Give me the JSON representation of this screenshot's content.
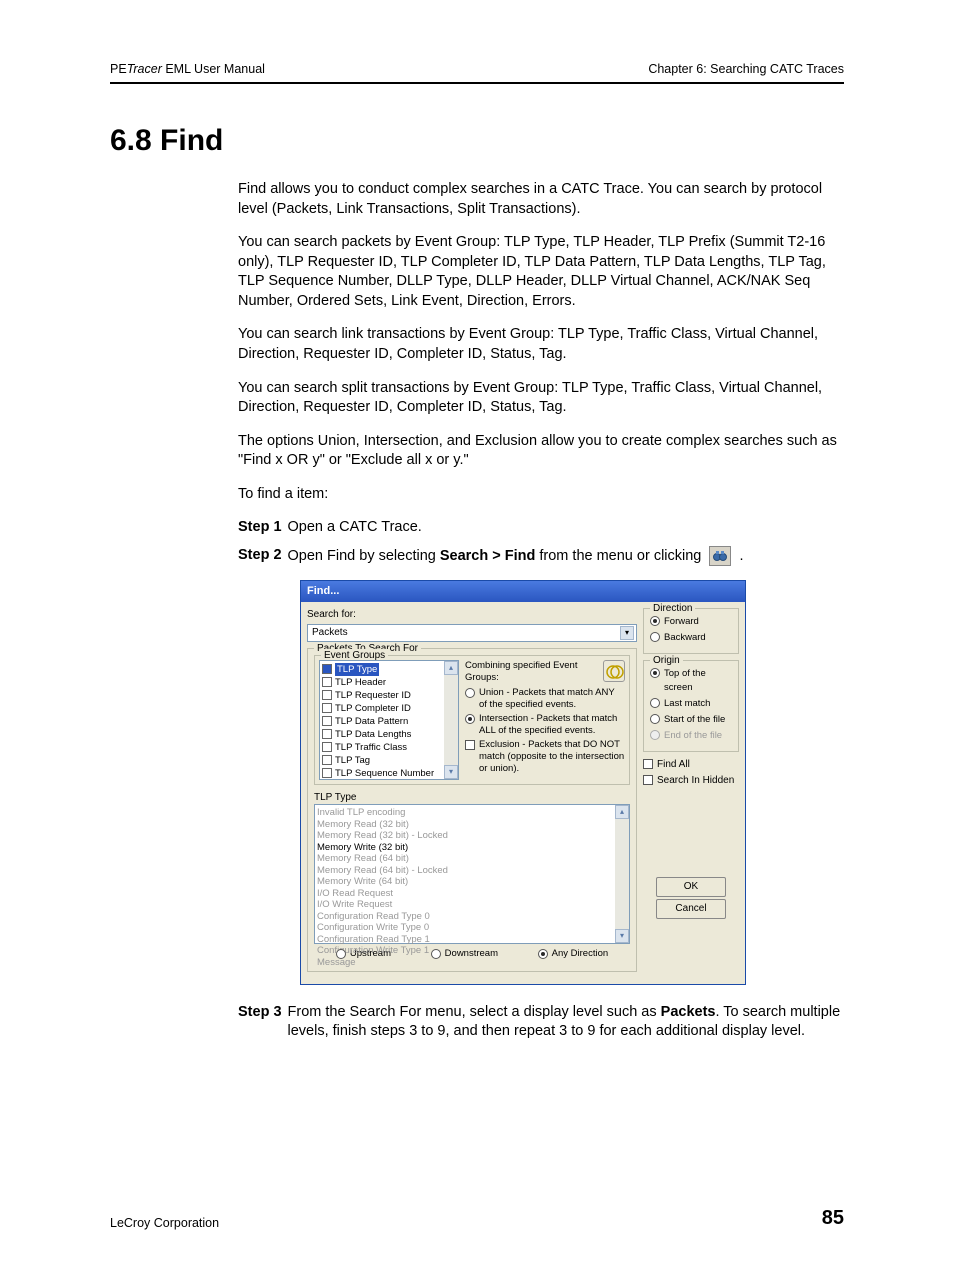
{
  "header": {
    "left_prefix": "PE",
    "left_italic": "Tracer",
    "left_suffix": " EML User Manual",
    "right": "Chapter 6: Searching CATC Traces"
  },
  "heading": "6.8 Find",
  "paragraphs": {
    "p1": "Find allows you to conduct complex searches in a CATC Trace. You can search by protocol level (Packets, Link Transactions, Split Transactions).",
    "p2": "You can search packets by Event Group: TLP Type, TLP Header, TLP Prefix (Summit T2-16 only), TLP Requester ID, TLP Completer ID, TLP Data Pattern, TLP Data Lengths, TLP Tag, TLP Sequence Number,  DLLP Type, DLLP Header, DLLP Virtual Channel, ACK/NAK Seq Number, Ordered Sets, Link Event, Direction, Errors.",
    "p3": "You can search link transactions by Event Group: TLP Type, Traffic Class, Virtual Channel, Direction, Requester ID, Completer ID, Status, Tag.",
    "p4": "You can search split transactions by Event Group: TLP Type, Traffic Class, Virtual Channel, Direction, Requester ID, Completer ID, Status, Tag.",
    "p5": "The options Union, Intersection, and Exclusion allow you to create complex searches such as \"Find x OR y\" or \"Exclude all x or y.\"",
    "p6": "To find a item:"
  },
  "steps": {
    "s1_label": "Step 1",
    "s1_text": "Open a CATC Trace.",
    "s2_label": "Step 2",
    "s2_pre": "Open Find by selecting ",
    "s2_bold": "Search > Find",
    "s2_post": " from the menu or clicking ",
    "s2_tail": " .",
    "s3_label": "Step 3",
    "s3_pre": "From the Search For menu, select a display level such as ",
    "s3_bold": "Packets",
    "s3_post": ". To search multiple levels, finish steps 3 to 9, and then repeat 3 to 9 for each additional display level."
  },
  "dialog": {
    "title": "Find...",
    "search_for_label": "Search for:",
    "search_for_value": "Packets",
    "packets_group": "Packets To Search For",
    "event_groups_label": "Event Groups",
    "event_items": [
      {
        "label": "TLP Type",
        "checked": true
      },
      {
        "label": "TLP Header",
        "checked": false
      },
      {
        "label": "TLP Requester ID",
        "checked": false
      },
      {
        "label": "TLP Completer ID",
        "checked": false
      },
      {
        "label": "TLP Data Pattern",
        "checked": false
      },
      {
        "label": "TLP Data Lengths",
        "checked": false
      },
      {
        "label": "TLP Traffic Class",
        "checked": false
      },
      {
        "label": "TLP Tag",
        "checked": false
      },
      {
        "label": "TLP Sequence Number",
        "checked": false
      }
    ],
    "combining_label": "Combining specified Event Groups:",
    "combine_union": "Union - Packets that match ANY of the specified events.",
    "combine_intersection": "Intersection - Packets that match ALL of the specified events.",
    "combine_exclusion": "Exclusion - Packets that DO NOT match (opposite to the intersection or union).",
    "tlp_type_label": "TLP Type",
    "tlp_items": [
      {
        "label": "Invalid TLP encoding",
        "enabled": false
      },
      {
        "label": "Memory Read (32 bit)",
        "enabled": false
      },
      {
        "label": "Memory Read (32 bit) - Locked",
        "enabled": false
      },
      {
        "label": "Memory Write (32 bit)",
        "enabled": true
      },
      {
        "label": "Memory Read (64 bit)",
        "enabled": false
      },
      {
        "label": "Memory Read (64 bit) - Locked",
        "enabled": false
      },
      {
        "label": "Memory Write (64 bit)",
        "enabled": false
      },
      {
        "label": "I/O Read Request",
        "enabled": false
      },
      {
        "label": "I/O Write Request",
        "enabled": false
      },
      {
        "label": "Configuration Read Type 0",
        "enabled": false
      },
      {
        "label": "Configuration Write Type 0",
        "enabled": false
      },
      {
        "label": "Configuration Read Type 1",
        "enabled": false
      },
      {
        "label": "Configuration Write Type 1",
        "enabled": false
      },
      {
        "label": "Message",
        "enabled": false
      }
    ],
    "dir_upstream": "Upstream",
    "dir_downstream": "Downstream",
    "dir_any": "Any Direction",
    "direction_group": "Direction",
    "dir_forward": "Forward",
    "dir_backward": "Backward",
    "origin_group": "Origin",
    "origin_items": [
      {
        "label": "Top of the screen",
        "on": true,
        "disabled": false
      },
      {
        "label": "Last match",
        "on": false,
        "disabled": false
      },
      {
        "label": "Start of the file",
        "on": false,
        "disabled": false
      },
      {
        "label": "End of the file",
        "on": false,
        "disabled": true
      }
    ],
    "find_all": "Find All",
    "search_hidden": "Search In Hidden",
    "ok": "OK",
    "cancel": "Cancel"
  },
  "footer": {
    "left": "LeCroy Corporation",
    "page": "85"
  }
}
